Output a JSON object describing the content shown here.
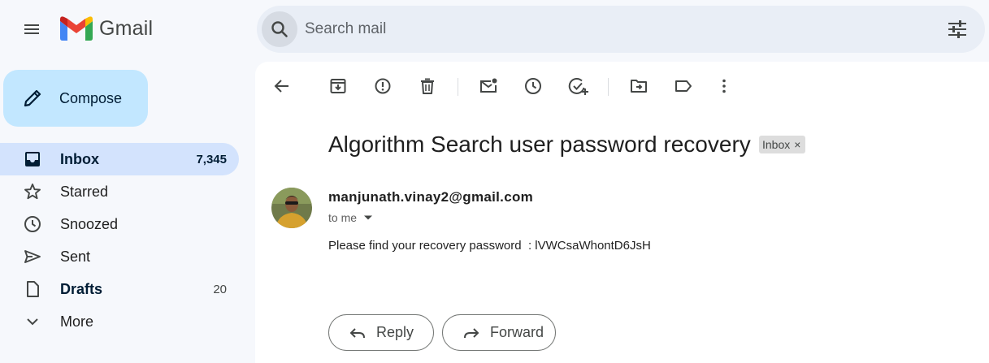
{
  "header": {
    "app_name": "Gmail",
    "menu_icon": "hamburger-menu-icon",
    "search_placeholder": "Search mail",
    "search_icon": "search-icon",
    "filter_icon": "search-options-icon"
  },
  "colors": {
    "page_bg": "#f6f8fc",
    "search_bg": "#e9eef6",
    "compose_bg": "#c2e7ff",
    "active_nav_bg": "#d3e3fd",
    "gmail_red": "#ea4335",
    "gmail_blue": "#4285f4",
    "gmail_green": "#34a853",
    "gmail_yellow": "#fbbc04"
  },
  "sidebar": {
    "compose_label": "Compose",
    "items": [
      {
        "label": "Inbox",
        "count": "7,345",
        "icon": "inbox-icon",
        "active": true,
        "bold": true
      },
      {
        "label": "Starred",
        "count": "",
        "icon": "star-icon",
        "active": false,
        "bold": false
      },
      {
        "label": "Snoozed",
        "count": "",
        "icon": "clock-icon",
        "active": false,
        "bold": false
      },
      {
        "label": "Sent",
        "count": "",
        "icon": "send-icon",
        "active": false,
        "bold": false
      },
      {
        "label": "Drafts",
        "count": "20",
        "icon": "draft-icon",
        "active": false,
        "bold": true
      },
      {
        "label": "More",
        "count": "",
        "icon": "chevron-down-icon",
        "active": false,
        "bold": false
      }
    ]
  },
  "toolbar": {
    "buttons": [
      "back-icon",
      "archive-icon",
      "report-spam-icon",
      "delete-icon",
      "mark-unread-icon",
      "snooze-icon",
      "add-to-tasks-icon",
      "move-to-icon",
      "label-icon",
      "more-options-icon"
    ]
  },
  "message": {
    "subject": "Algorithm Search user password recovery",
    "label_chip": "Inbox",
    "label_chip_close": "×",
    "sender": "manjunath.vinay2@gmail.com",
    "recipient": "to me",
    "body": "Please find your recovery password  : lVWCsaWhontD6JsH",
    "reply_label": "Reply",
    "forward_label": "Forward"
  }
}
